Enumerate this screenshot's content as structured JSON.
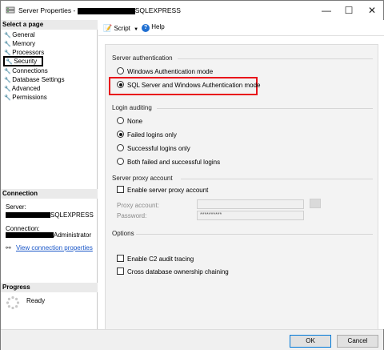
{
  "window": {
    "title_prefix": "Server Properties -",
    "title_suffix": "SQLEXPRESS",
    "minimize_glyph": "—",
    "maximize_glyph": "☐",
    "close_glyph": "✕"
  },
  "left_panel": {
    "select_page_header": "Select a page",
    "pages": [
      {
        "label": "General",
        "icon": "wrench-icon"
      },
      {
        "label": "Memory",
        "icon": "wrench-icon"
      },
      {
        "label": "Processors",
        "icon": "wrench-icon"
      },
      {
        "label": "Security",
        "icon": "wrench-icon",
        "selected": true
      },
      {
        "label": "Connections",
        "icon": "wrench-icon"
      },
      {
        "label": "Database Settings",
        "icon": "wrench-icon"
      },
      {
        "label": "Advanced",
        "icon": "wrench-icon"
      },
      {
        "label": "Permissions",
        "icon": "wrench-icon"
      }
    ],
    "connection_header": "Connection",
    "server_label": "Server:",
    "server_value_suffix": "SQLEXPRESS",
    "connection_label": "Connection:",
    "connection_value_suffix": "Administrator",
    "view_connection_properties": "View connection properties",
    "progress_header": "Progress",
    "progress_status": "Ready"
  },
  "toolbar": {
    "script_label": "Script",
    "help_label": "Help"
  },
  "security": {
    "server_auth_title": "Server authentication",
    "auth_options": [
      {
        "label": "Windows Authentication mode",
        "checked": false
      },
      {
        "label": "SQL Server and Windows Authentication mode",
        "checked": true
      }
    ],
    "login_auditing_title": "Login auditing",
    "audit_options": [
      {
        "label": "None",
        "checked": false
      },
      {
        "label": "Failed logins only",
        "checked": true
      },
      {
        "label": "Successful logins only",
        "checked": false
      },
      {
        "label": "Both failed and successful logins",
        "checked": false
      }
    ],
    "proxy_title": "Server proxy account",
    "enable_proxy_label": "Enable server proxy account",
    "proxy_account_label": "Proxy account:",
    "password_label": "Password:",
    "password_value": "**********",
    "options_title": "Options",
    "c2_audit_label": "Enable C2 audit tracing",
    "cross_db_label": "Cross database ownership chaining"
  },
  "buttons": {
    "ok": "OK",
    "cancel": "Cancel"
  },
  "colors": {
    "highlight_red": "#e8141b",
    "link_blue": "#1a57c8"
  }
}
